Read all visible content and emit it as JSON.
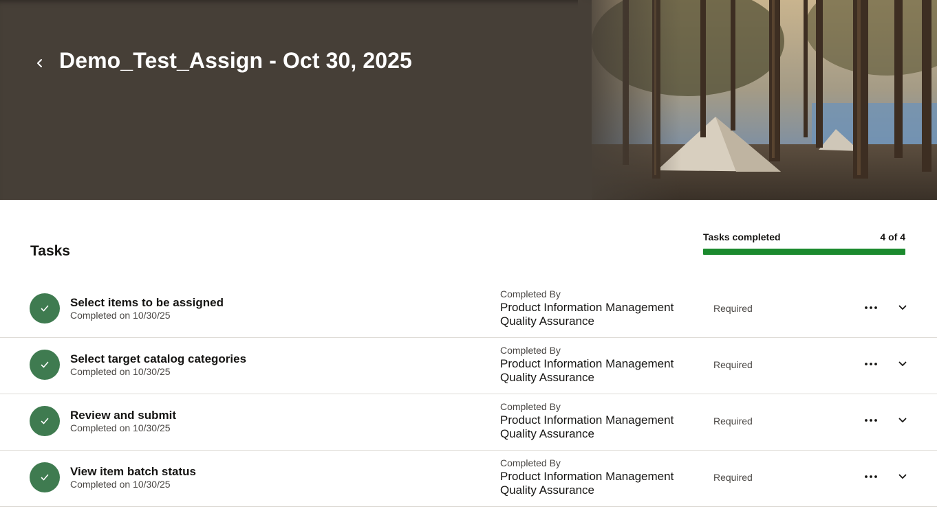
{
  "header": {
    "title": "Demo_Test_Assign - Oct 30, 2025",
    "back_icon": "chevron-left-icon",
    "banner_image": "forest-tent-photo"
  },
  "tasks": {
    "heading": "Tasks",
    "progress": {
      "label": "Tasks completed",
      "count_text": "4 of 4",
      "completed": 4,
      "total": 4,
      "fill_color": "#1b8a2e"
    },
    "items": [
      {
        "title": "Select items to be assigned",
        "status": "Completed on 10/30/25",
        "completed_by_label": "Completed By",
        "completed_by": "Product Information Management Quality Assurance",
        "requirement": "Required"
      },
      {
        "title": "Select target catalog categories",
        "status": "Completed on 10/30/25",
        "completed_by_label": "Completed By",
        "completed_by": "Product Information Management Quality Assurance",
        "requirement": "Required"
      },
      {
        "title": "Review and submit",
        "status": "Completed on 10/30/25",
        "completed_by_label": "Completed By",
        "completed_by": "Product Information Management Quality Assurance",
        "requirement": "Required"
      },
      {
        "title": "View item batch status",
        "status": "Completed on 10/30/25",
        "completed_by_label": "Completed By",
        "completed_by": "Product Information Management Quality Assurance",
        "requirement": "Required"
      }
    ]
  },
  "colors": {
    "banner_bg": "#463f37",
    "check_circle": "#3f7b50",
    "progress_fill": "#1b8a2e"
  }
}
